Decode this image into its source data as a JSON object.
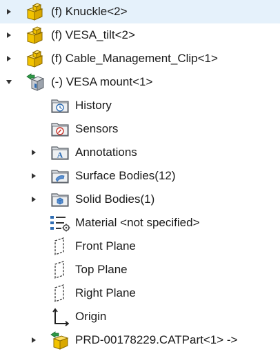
{
  "tree": {
    "items": [
      {
        "label": "(f) Knuckle<2>",
        "icon": "assembly-part-icon",
        "expander": "collapsed"
      },
      {
        "label": "(f) VESA_tilt<2>",
        "icon": "assembly-part-icon",
        "expander": "collapsed"
      },
      {
        "label": "(f) Cable_Management_Clip<1>",
        "icon": "assembly-part-icon",
        "expander": "collapsed"
      },
      {
        "label": "(-) VESA mount<1>",
        "icon": "part-icon",
        "expander": "expanded"
      },
      {
        "label": "History",
        "icon": "history-folder-icon",
        "expander": "none"
      },
      {
        "label": "Sensors",
        "icon": "sensors-folder-icon",
        "expander": "none"
      },
      {
        "label": "Annotations",
        "icon": "annotations-folder-icon",
        "expander": "collapsed"
      },
      {
        "label": "Surface Bodies(12)",
        "icon": "surface-bodies-folder-icon",
        "expander": "collapsed"
      },
      {
        "label": "Solid Bodies(1)",
        "icon": "solid-bodies-folder-icon",
        "expander": "collapsed"
      },
      {
        "label": "Material <not specified>",
        "icon": "material-icon",
        "expander": "none"
      },
      {
        "label": "Front Plane",
        "icon": "plane-icon",
        "expander": "none"
      },
      {
        "label": "Top Plane",
        "icon": "plane-icon",
        "expander": "none"
      },
      {
        "label": "Right Plane",
        "icon": "plane-icon",
        "expander": "none"
      },
      {
        "label": "Origin",
        "icon": "origin-icon",
        "expander": "none"
      },
      {
        "label": "PRD-00178229.CATPart<1> ->",
        "icon": "external-reference-part-icon",
        "expander": "collapsed"
      }
    ]
  },
  "colors": {
    "part_yellow": "#f2c300",
    "part_outline": "#8a6a00",
    "folder_fill": "#d4d8dd",
    "folder_outline": "#5a6068",
    "accent_blue": "#2f6db3",
    "accent_red": "#c8342b",
    "accent_green": "#2e9a47",
    "text": "#1a1a1a"
  }
}
